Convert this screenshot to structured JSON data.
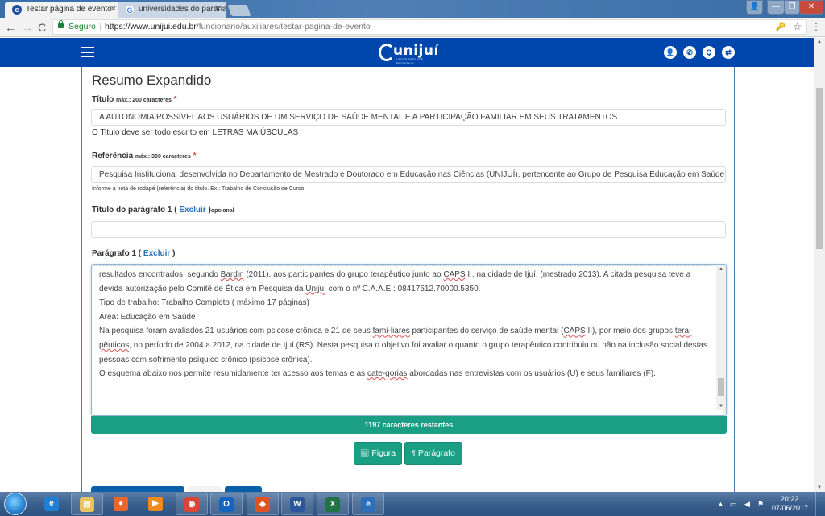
{
  "browser": {
    "tabs": [
      {
        "label": "Testar página de evento",
        "favicon": "unijui-favicon",
        "active": true
      },
      {
        "label": "universidades do parana",
        "favicon": "google-favicon",
        "active": false
      }
    ],
    "window_controls": {
      "user": "👤",
      "minimize": "—",
      "maximize": "❐",
      "close": "✕"
    },
    "nav": {
      "back": "←",
      "forward": "→",
      "reload": "C"
    },
    "address": {
      "secure_label": "Seguro",
      "url_host": "https://www.unijui.edu.br",
      "url_path": "/funcionario/auxiliares/testar-pagina-de-evento",
      "key_icon": "🔑",
      "star_icon": "☆"
    },
    "menu_icon": "⋮"
  },
  "site_header": {
    "logo_text": "unijuí",
    "logo_subtext": "UNIVERSIDADE REGIONAL",
    "icons": [
      {
        "name": "user-icon",
        "glyph": "👤"
      },
      {
        "name": "phone-icon",
        "glyph": "✆"
      },
      {
        "name": "search-icon",
        "glyph": "Q"
      },
      {
        "name": "translate-icon",
        "glyph": "⇄"
      }
    ]
  },
  "form": {
    "section_title": "Resumo Expandido",
    "titulo": {
      "label": "Título",
      "limit": "máx.: 200 caracteres",
      "required_mark": "*",
      "value": "A AUTONOMIA POSSÍVEL AOS USUÁRIOS DE UM SERVIÇO DE SAÚDE MENTAL E A PARTICIPAÇÃO FAMILIAR EM SEUS TRATAMENTOS",
      "help": "O Titulo deve ser todo escrito em LETRAS MAIÚSCULAS"
    },
    "referencia": {
      "label": "Referência",
      "limit": "máx.: 300 caracteres",
      "required_mark": "*",
      "value": "Pesquisa Institucional desenvolvida no Departamento de Mestrado e Doutorado em Educação nas Ciências (UNIJUÍ), pertencente ao Grupo de Pesquisa Educação em Saúde",
      "help": "Informe a nota de rodapé (referência) do título. Ex.: Trabalho de Conclusão de Curso."
    },
    "titulo_paragrafo": {
      "label_prefix": "Título do parágrafo 1 (",
      "delete_link": "Excluir",
      "label_suffix": ")",
      "optional": "opcional",
      "value": ""
    },
    "paragrafo": {
      "label_prefix": "Parágrafo 1 (",
      "delete_link": "Excluir",
      "label_suffix": ")",
      "lines": [
        [
          "resultados encontrados, segundo ",
          {
            "spell": "Bardin"
          },
          " (2011), aos participantes do grupo terapêutico junto ao ",
          {
            "spell": "CAPS"
          },
          " II, na cidade de Ijuí, (mestrado 2013). A citada pesquisa teve a"
        ],
        [
          "devida autorização pelo Comitê de Ética em Pesquisa da ",
          {
            "spell": "Unijuí"
          },
          " com o nº C.A.A.E.: 08417512.70000.5350."
        ],
        [
          "Tipo de trabalho: Trabalho Completo ( máximo 17 páginas)"
        ],
        [
          "Área: Educação em Saúde"
        ],
        [
          "Na pesquisa foram avaliados 21 usuários com psicose crônica e 21 de seus ",
          {
            "spell": "fami-liares"
          },
          " participantes do serviço de saúde mental (",
          {
            "spell": "CAPS"
          },
          " II), por meio dos grupos ",
          {
            "spell": "tera-"
          }
        ],
        [
          {
            "spell": "pêuticos"
          },
          ", no período de 2004 a 2012, na cidade de Ijuí (RS). Nesta pesquisa o objetivo foi avaliar o quanto o grupo terapêutico contribuiu ou não na inclusão social destas"
        ],
        [
          "pessoas com sofrimento psíquico crônico (psicose crônica)."
        ],
        [
          "O esquema abaixo nos permite resumidamente ter acesso aos temas e as ",
          {
            "spell": "cate-gorias"
          },
          " abordadas nas entrevistas com os usuários (U) e seus familiares (F)."
        ]
      ],
      "remaining_counter": "1197 caracteres restantes"
    },
    "buttons": {
      "figura": {
        "icon": "🖼",
        "label": "Figura"
      },
      "paragrafo": {
        "icon": "¶",
        "label": "Parágrafo"
      }
    }
  },
  "taskbar": {
    "apps": [
      {
        "name": "internet-explorer",
        "glyph": "e",
        "color": "#1e7fd6",
        "pinned": false
      },
      {
        "name": "file-explorer",
        "glyph": "▤",
        "color": "#e8c45a",
        "pinned": true
      },
      {
        "name": "firefox",
        "glyph": "●",
        "color": "#e8662a",
        "pinned": false
      },
      {
        "name": "media-player",
        "glyph": "▶",
        "color": "#f08a1c",
        "pinned": false
      },
      {
        "name": "chrome",
        "glyph": "◉",
        "color": "#db4437",
        "pinned": true
      },
      {
        "name": "outlook",
        "glyph": "O",
        "color": "#1565c0",
        "pinned": true
      },
      {
        "name": "office-app",
        "glyph": "◆",
        "color": "#e0531f",
        "pinned": true
      },
      {
        "name": "word",
        "glyph": "W",
        "color": "#2b579a",
        "pinned": true
      },
      {
        "name": "excel",
        "glyph": "X",
        "color": "#217346",
        "pinned": true
      },
      {
        "name": "unijui-app",
        "glyph": "e",
        "color": "#2d6fb8",
        "pinned": true
      }
    ],
    "tray": {
      "arrow": "▲",
      "network": "▭",
      "volume": "◀",
      "flag": "⚑"
    },
    "clock": {
      "time": "20:22",
      "date": "07/06/2017"
    }
  },
  "colors": {
    "header_blue": "#0047ad",
    "accent_teal": "#1a9f85",
    "link_blue": "#2a6fb8",
    "required_red": "#d9534f"
  }
}
